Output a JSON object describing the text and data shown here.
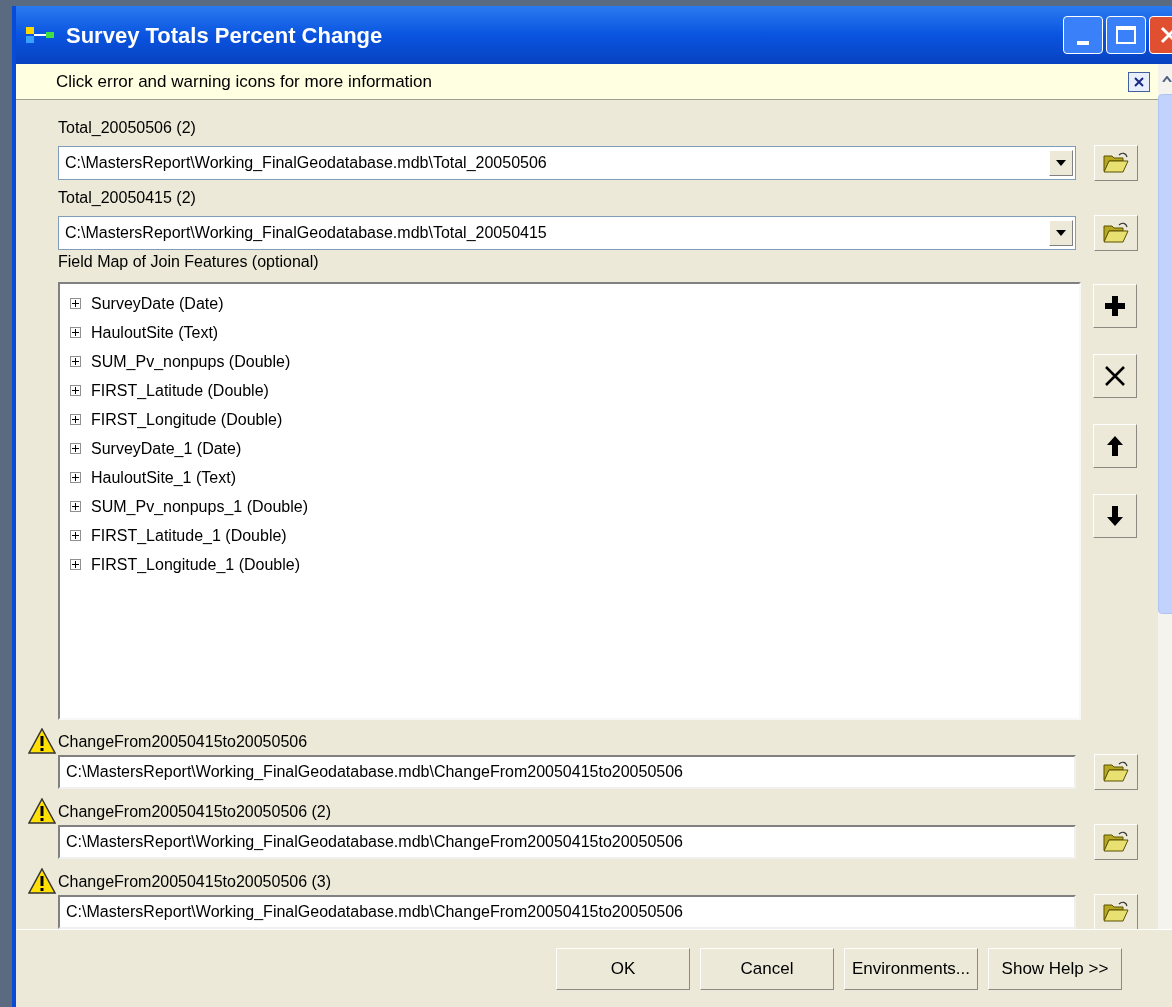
{
  "window": {
    "title": "Survey Totals Percent Change"
  },
  "info_bar": {
    "message": "Click error and warning icons for more information"
  },
  "inputs": [
    {
      "label": "Total_20050506 (2)",
      "value": "C:\\MastersReport\\Working_FinalGeodatabase.mdb\\Total_20050506"
    },
    {
      "label": "Total_20050415 (2)",
      "value": "C:\\MastersReport\\Working_FinalGeodatabase.mdb\\Total_20050415"
    }
  ],
  "field_map": {
    "label": "Field Map of Join Features (optional)",
    "items": [
      "SurveyDate (Date)",
      "HauloutSite (Text)",
      "SUM_Pv_nonpups (Double)",
      "FIRST_Latitude (Double)",
      "FIRST_Longitude (Double)",
      "SurveyDate_1 (Date)",
      "HauloutSite_1 (Text)",
      "SUM_Pv_nonpups_1 (Double)",
      "FIRST_Latitude_1 (Double)",
      "FIRST_Longitude_1 (Double)"
    ]
  },
  "outputs": [
    {
      "label": "ChangeFrom20050415to20050506",
      "warning": true,
      "value": "C:\\MastersReport\\Working_FinalGeodatabase.mdb\\ChangeFrom20050415to20050506"
    },
    {
      "label": "ChangeFrom20050415to20050506 (2)",
      "warning": true,
      "value": "C:\\MastersReport\\Working_FinalGeodatabase.mdb\\ChangeFrom20050415to20050506"
    },
    {
      "label": "ChangeFrom20050415to20050506 (3)",
      "warning": true,
      "value": "C:\\MastersReport\\Working_FinalGeodatabase.mdb\\ChangeFrom20050415to20050506"
    }
  ],
  "buttons": [
    "OK",
    "Cancel",
    "Environments...",
    "Show Help >>"
  ]
}
